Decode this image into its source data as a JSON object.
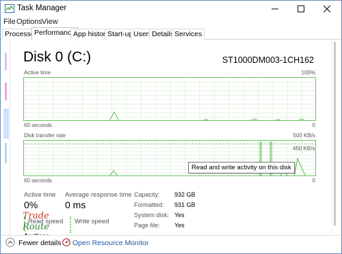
{
  "window": {
    "title": "Task Manager"
  },
  "menu": {
    "file": "File",
    "options": "Options",
    "view": "View"
  },
  "tabs": [
    {
      "label": "Processes"
    },
    {
      "label": "Performance"
    },
    {
      "label": "App history"
    },
    {
      "label": "Start-up"
    },
    {
      "label": "Users"
    },
    {
      "label": "Details"
    },
    {
      "label": "Services"
    }
  ],
  "active_tab": "Performance",
  "disk": {
    "title": "Disk 0 (C:)",
    "model": "ST1000DM003-1CH162"
  },
  "active_time_chart": {
    "label": "Active time",
    "max_label": "100%",
    "time_label": "60 seconds",
    "min_label": "0"
  },
  "transfer_chart": {
    "label": "Disk transfer rate",
    "max_label": "500 KB/s",
    "secondary_label": "450 KB/s",
    "time_label": "60 seconds",
    "min_label": "0"
  },
  "tooltip": "Read and write activity on this disk",
  "stats": {
    "active_time_label": "Active time",
    "active_time_value": "0%",
    "avg_response_label": "Average response time",
    "avg_response_value": "0 ms",
    "read_speed_label": "Read speed",
    "write_speed_label": "Write speed"
  },
  "properties": [
    {
      "key": "Capacity:",
      "value": "932 GB"
    },
    {
      "key": "Formatted:",
      "value": "931 GB"
    },
    {
      "key": "System disk:",
      "value": "Yes"
    },
    {
      "key": "Page file:",
      "value": "Yes"
    }
  ],
  "footer": {
    "fewer_details": "Fewer details",
    "open_resource_monitor": "Open Resource Monitor"
  },
  "colors": {
    "graph_border": "#67c55f",
    "graph_line": "#5bbd4f",
    "link": "#1a57b4"
  },
  "icons": {
    "app": "task-manager-icon",
    "minimize": "minimize-icon",
    "maximize": "maximize-icon",
    "close": "close-icon",
    "fewer": "chevron-up-circle-icon",
    "resmon": "resource-monitor-icon"
  }
}
